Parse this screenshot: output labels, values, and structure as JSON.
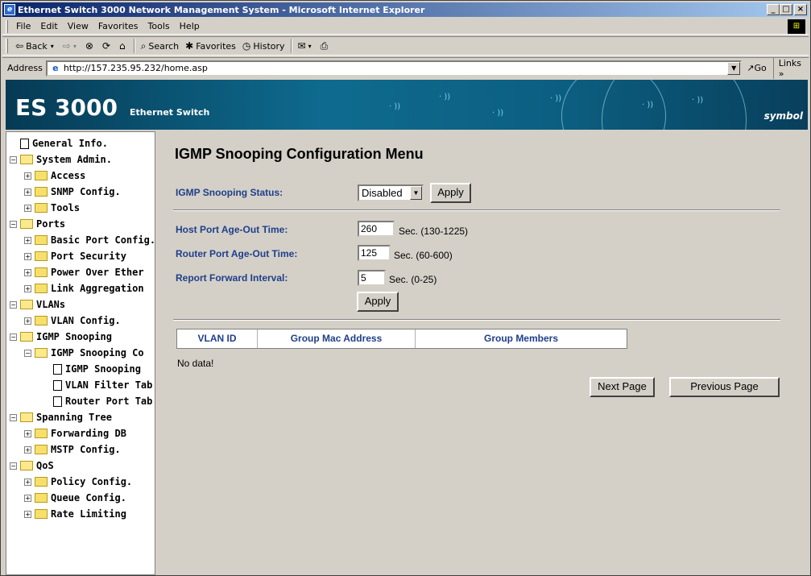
{
  "window": {
    "title": "Ethernet Switch 3000 Network Management System - Microsoft Internet Explorer",
    "min": "_",
    "max": "□",
    "close": "×"
  },
  "menu": [
    "File",
    "Edit",
    "View",
    "Favorites",
    "Tools",
    "Help"
  ],
  "toolbar": {
    "back": "Back",
    "search": "Search",
    "favorites": "Favorites",
    "history": "History"
  },
  "address": {
    "label": "Address",
    "url": "http://157.235.95.232/home.asp",
    "go": "Go",
    "links": "Links"
  },
  "banner": {
    "product": "ES 3000",
    "subtitle": "Ethernet Switch",
    "brand": "symbol"
  },
  "tree": [
    {
      "label": "General Info.",
      "level": 0,
      "kind": "doc",
      "toggle": ""
    },
    {
      "label": "System Admin.",
      "level": 0,
      "kind": "open",
      "toggle": "−"
    },
    {
      "label": "Access",
      "level": 1,
      "kind": "folder",
      "toggle": "+"
    },
    {
      "label": "SNMP Config.",
      "level": 1,
      "kind": "folder",
      "toggle": "+"
    },
    {
      "label": "Tools",
      "level": 1,
      "kind": "folder",
      "toggle": "+"
    },
    {
      "label": "Ports",
      "level": 0,
      "kind": "open",
      "toggle": "−"
    },
    {
      "label": "Basic Port Config.",
      "level": 1,
      "kind": "folder",
      "toggle": "+"
    },
    {
      "label": "Port Security",
      "level": 1,
      "kind": "folder",
      "toggle": "+"
    },
    {
      "label": "Power Over Ether",
      "level": 1,
      "kind": "folder",
      "toggle": "+"
    },
    {
      "label": "Link Aggregation",
      "level": 1,
      "kind": "folder",
      "toggle": "+"
    },
    {
      "label": "VLANs",
      "level": 0,
      "kind": "open",
      "toggle": "−"
    },
    {
      "label": "VLAN Config.",
      "level": 1,
      "kind": "folder",
      "toggle": "+"
    },
    {
      "label": "IGMP Snooping",
      "level": 0,
      "kind": "open",
      "toggle": "−"
    },
    {
      "label": "IGMP Snooping Co",
      "level": 1,
      "kind": "open",
      "toggle": "−"
    },
    {
      "label": "IGMP Snooping",
      "level": 2,
      "kind": "doc",
      "toggle": ""
    },
    {
      "label": "VLAN Filter Tab",
      "level": 2,
      "kind": "doc",
      "toggle": ""
    },
    {
      "label": "Router Port Tab",
      "level": 2,
      "kind": "doc",
      "toggle": ""
    },
    {
      "label": "Spanning Tree",
      "level": 0,
      "kind": "open",
      "toggle": "−"
    },
    {
      "label": "Forwarding DB",
      "level": 1,
      "kind": "folder",
      "toggle": "+"
    },
    {
      "label": "MSTP Config.",
      "level": 1,
      "kind": "folder",
      "toggle": "+"
    },
    {
      "label": "QoS",
      "level": 0,
      "kind": "open",
      "toggle": "−"
    },
    {
      "label": "Policy Config.",
      "level": 1,
      "kind": "folder",
      "toggle": "+"
    },
    {
      "label": "Queue Config.",
      "level": 1,
      "kind": "folder",
      "toggle": "+"
    },
    {
      "label": "Rate Limiting",
      "level": 1,
      "kind": "folder",
      "toggle": "+"
    }
  ],
  "page": {
    "title": "IGMP Snooping Configuration Menu",
    "status_label": "IGMP Snooping Status:",
    "status_value": "Disabled",
    "apply1": "Apply",
    "host_label": "Host Port Age-Out Time:",
    "host_value": "260",
    "host_unit": "Sec. (130-1225)",
    "router_label": "Router Port Age-Out Time:",
    "router_value": "125",
    "router_unit": "Sec. (60-600)",
    "report_label": "Report Forward Interval:",
    "report_value": "5",
    "report_unit": "Sec. (0-25)",
    "apply2": "Apply",
    "table_headers": [
      "VLAN ID",
      "Group Mac Address",
      "Group Members"
    ],
    "no_data": "No data!",
    "next": "Next Page",
    "prev": "Previous Page"
  }
}
